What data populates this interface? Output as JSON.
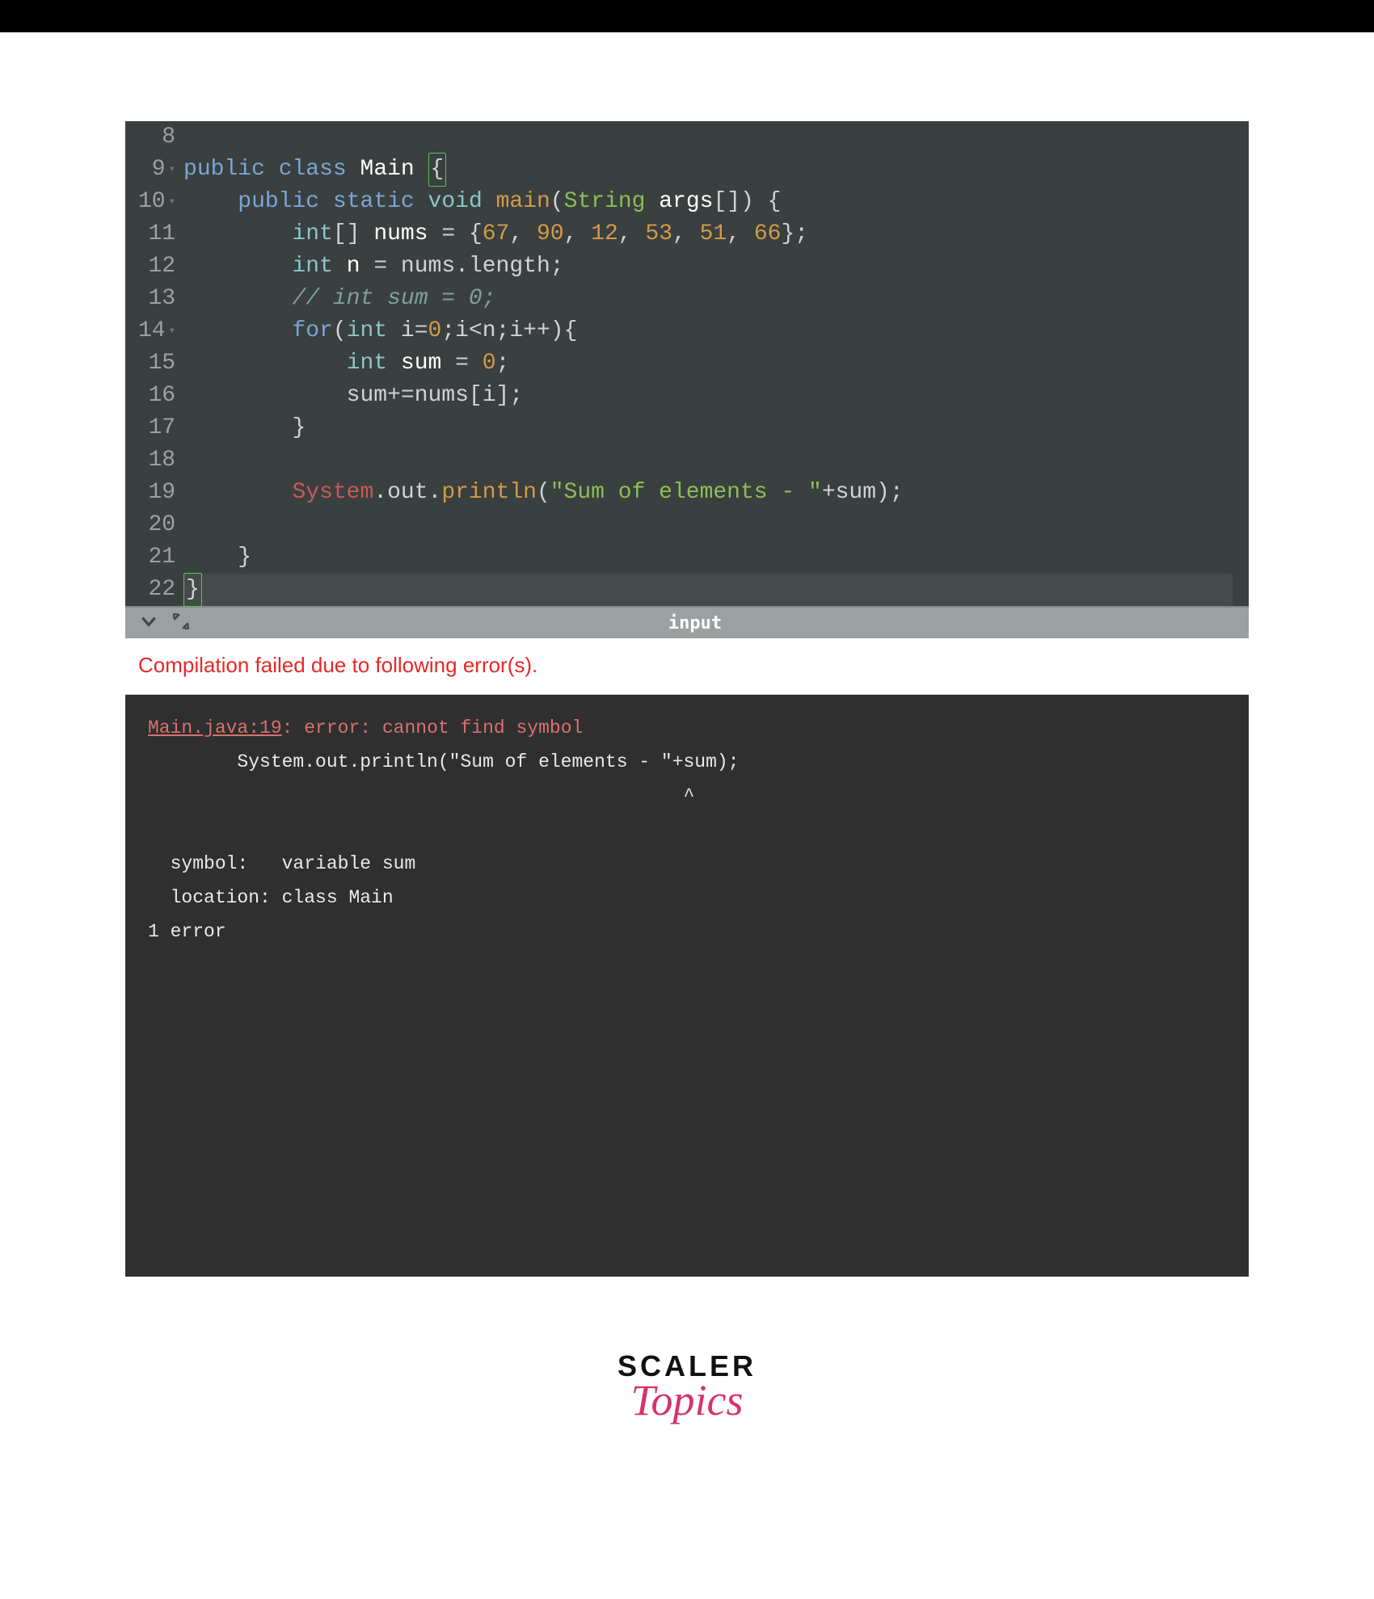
{
  "editor": {
    "lines": [
      {
        "num": "8",
        "fold": "",
        "tokens": []
      },
      {
        "num": "9",
        "fold": "▾",
        "tokens": [
          {
            "cls": "kw-blue",
            "t": "public"
          },
          {
            "cls": "punct",
            "t": " "
          },
          {
            "cls": "kw-blue",
            "t": "class"
          },
          {
            "cls": "punct",
            "t": " "
          },
          {
            "cls": "fn-name",
            "t": "Main"
          },
          {
            "cls": "punct",
            "t": " "
          },
          {
            "cls": "bracket-hl",
            "t": "{"
          }
        ]
      },
      {
        "num": "10",
        "fold": "▾",
        "tokens": [
          {
            "cls": "punct",
            "t": "    "
          },
          {
            "cls": "kw-blue",
            "t": "public"
          },
          {
            "cls": "punct",
            "t": " "
          },
          {
            "cls": "kw-blue",
            "t": "static"
          },
          {
            "cls": "punct",
            "t": " "
          },
          {
            "cls": "kw-teal",
            "t": "void"
          },
          {
            "cls": "punct",
            "t": " "
          },
          {
            "cls": "kw-orange",
            "t": "main"
          },
          {
            "cls": "punct",
            "t": "("
          },
          {
            "cls": "kw-green",
            "t": "String"
          },
          {
            "cls": "punct",
            "t": " "
          },
          {
            "cls": "fn-name",
            "t": "args"
          },
          {
            "cls": "punct",
            "t": "[]) {"
          }
        ]
      },
      {
        "num": "11",
        "fold": "",
        "tokens": [
          {
            "cls": "punct",
            "t": "        "
          },
          {
            "cls": "kw-teal",
            "t": "int"
          },
          {
            "cls": "punct",
            "t": "[] "
          },
          {
            "cls": "fn-name",
            "t": "nums"
          },
          {
            "cls": "punct",
            "t": " = {"
          },
          {
            "cls": "num",
            "t": "67"
          },
          {
            "cls": "punct",
            "t": ", "
          },
          {
            "cls": "num",
            "t": "90"
          },
          {
            "cls": "punct",
            "t": ", "
          },
          {
            "cls": "num",
            "t": "12"
          },
          {
            "cls": "punct",
            "t": ", "
          },
          {
            "cls": "num",
            "t": "53"
          },
          {
            "cls": "punct",
            "t": ", "
          },
          {
            "cls": "num",
            "t": "51"
          },
          {
            "cls": "punct",
            "t": ", "
          },
          {
            "cls": "num",
            "t": "66"
          },
          {
            "cls": "punct",
            "t": "};"
          }
        ]
      },
      {
        "num": "12",
        "fold": "",
        "tokens": [
          {
            "cls": "punct",
            "t": "        "
          },
          {
            "cls": "kw-teal",
            "t": "int"
          },
          {
            "cls": "punct",
            "t": " "
          },
          {
            "cls": "fn-name",
            "t": "n"
          },
          {
            "cls": "punct",
            "t": " = nums.length;"
          }
        ]
      },
      {
        "num": "13",
        "fold": "",
        "tokens": [
          {
            "cls": "punct",
            "t": "        "
          },
          {
            "cls": "comment",
            "t": "// int sum = 0;"
          }
        ]
      },
      {
        "num": "14",
        "fold": "▾",
        "tokens": [
          {
            "cls": "punct",
            "t": "        "
          },
          {
            "cls": "kw-blue",
            "t": "for"
          },
          {
            "cls": "punct",
            "t": "("
          },
          {
            "cls": "kw-teal",
            "t": "int"
          },
          {
            "cls": "punct",
            "t": " i="
          },
          {
            "cls": "num",
            "t": "0"
          },
          {
            "cls": "punct",
            "t": ";i<n;i++){"
          }
        ]
      },
      {
        "num": "15",
        "fold": "",
        "tokens": [
          {
            "cls": "punct",
            "t": "            "
          },
          {
            "cls": "kw-teal",
            "t": "int"
          },
          {
            "cls": "punct",
            "t": " "
          },
          {
            "cls": "fn-name",
            "t": "sum"
          },
          {
            "cls": "punct",
            "t": " = "
          },
          {
            "cls": "num",
            "t": "0"
          },
          {
            "cls": "punct",
            "t": ";"
          }
        ]
      },
      {
        "num": "16",
        "fold": "",
        "tokens": [
          {
            "cls": "punct",
            "t": "            sum+=nums[i];"
          }
        ]
      },
      {
        "num": "17",
        "fold": "",
        "tokens": [
          {
            "cls": "punct",
            "t": "        }"
          }
        ]
      },
      {
        "num": "18",
        "fold": "",
        "tokens": []
      },
      {
        "num": "19",
        "fold": "",
        "tokens": [
          {
            "cls": "punct",
            "t": "        "
          },
          {
            "cls": "kw-red",
            "t": "System"
          },
          {
            "cls": "punct",
            "t": ".out."
          },
          {
            "cls": "kw-orange",
            "t": "println"
          },
          {
            "cls": "punct",
            "t": "("
          },
          {
            "cls": "str",
            "t": "\"Sum of elements - \""
          },
          {
            "cls": "punct",
            "t": "+sum);"
          }
        ]
      },
      {
        "num": "20",
        "fold": "",
        "tokens": []
      },
      {
        "num": "21",
        "fold": "",
        "tokens": [
          {
            "cls": "punct",
            "t": "    }"
          }
        ]
      },
      {
        "num": "22",
        "fold": "",
        "hl": true,
        "tokens": [
          {
            "cls": "bracket-hl",
            "t": "}"
          }
        ]
      }
    ]
  },
  "inputBar": {
    "label": "input"
  },
  "error": {
    "message": "Compilation failed due to following error(s)."
  },
  "console": {
    "head": "Main.java:19",
    "headRest": ": error: cannot find symbol",
    "line2": "        System.out.println(\"Sum of elements - \"+sum);",
    "caret": "                                                ^",
    "sym": "  symbol:   variable sum",
    "loc": "  location: class Main",
    "count": "1 error"
  },
  "logo": {
    "top": "SCALER",
    "bottom": "Topics"
  }
}
